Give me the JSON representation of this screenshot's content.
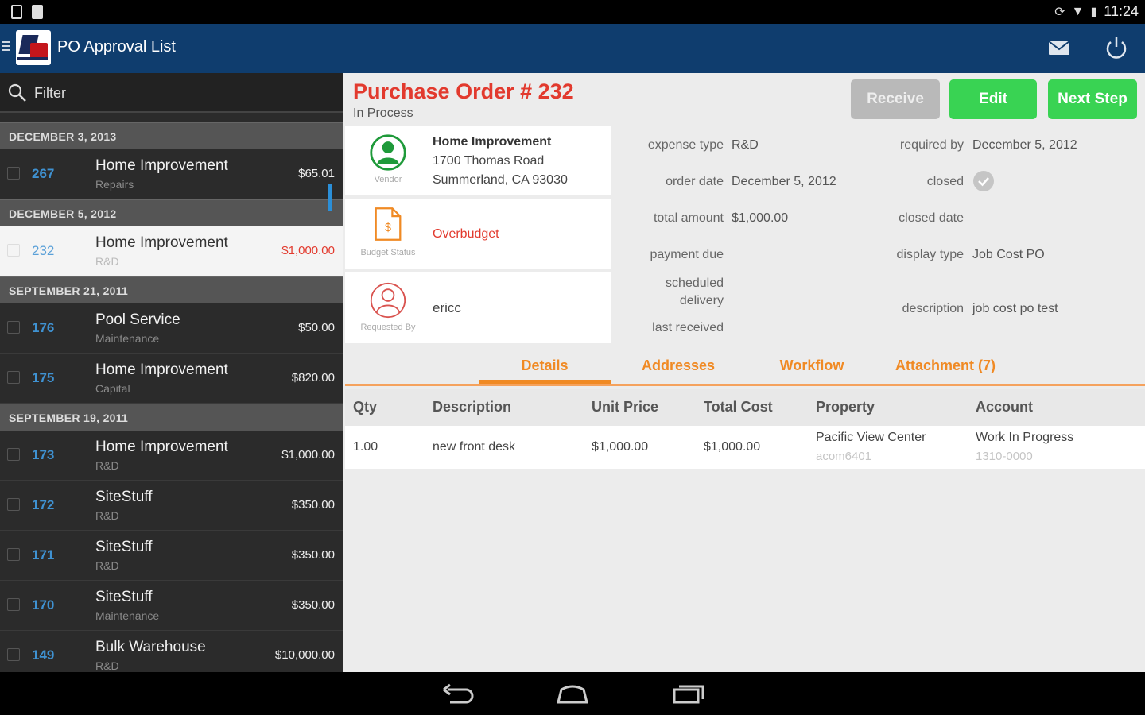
{
  "status_bar": {
    "time": "11:24"
  },
  "app_bar": {
    "title": "PO Approval List"
  },
  "filter": {
    "label": "Filter"
  },
  "list": {
    "sections": [
      {
        "date": "DECEMBER 3, 2013",
        "items": [
          {
            "number": "267",
            "vendor": "Home Improvement",
            "type": "Repairs",
            "amount": "$65.01"
          }
        ]
      },
      {
        "date": "DECEMBER 5, 2012",
        "items": [
          {
            "number": "232",
            "vendor": "Home Improvement",
            "type": "R&D",
            "amount": "$1,000.00",
            "selected": true
          }
        ]
      },
      {
        "date": "SEPTEMBER 21, 2011",
        "items": [
          {
            "number": "176",
            "vendor": "Pool Service",
            "type": "Maintenance",
            "amount": "$50.00"
          },
          {
            "number": "175",
            "vendor": "Home Improvement",
            "type": "Capital",
            "amount": "$820.00"
          }
        ]
      },
      {
        "date": "SEPTEMBER 19, 2011",
        "items": [
          {
            "number": "173",
            "vendor": "Home Improvement",
            "type": "R&D",
            "amount": "$1,000.00"
          },
          {
            "number": "172",
            "vendor": "SiteStuff",
            "type": "R&D",
            "amount": "$350.00"
          },
          {
            "number": "171",
            "vendor": "SiteStuff",
            "type": "R&D",
            "amount": "$350.00"
          },
          {
            "number": "170",
            "vendor": "SiteStuff",
            "type": "Maintenance",
            "amount": "$350.00"
          },
          {
            "number": "149",
            "vendor": "Bulk Warehouse",
            "type": "R&D",
            "amount": "$10,000.00"
          }
        ]
      }
    ]
  },
  "detail": {
    "title": "Purchase Order # 232",
    "status": "In Process",
    "buttons": {
      "receive": "Receive",
      "edit": "Edit",
      "next_step": "Next Step"
    },
    "vendor": {
      "caption": "Vendor",
      "name": "Home Improvement",
      "address": "1700 Thomas Road",
      "city": "Summerland, CA 93030"
    },
    "budget": {
      "caption": "Budget Status",
      "value": "Overbudget"
    },
    "requester": {
      "caption": "Requested By",
      "value": "ericc"
    },
    "fields": {
      "expense_type_label": "expense type",
      "expense_type": "R&D",
      "order_date_label": "order date",
      "order_date": "December 5, 2012",
      "total_amount_label": "total amount",
      "total_amount": "$1,000.00",
      "payment_due_label": "payment due",
      "scheduled_label_1": "scheduled",
      "scheduled_label_2": "delivery",
      "last_received_label": "last received",
      "required_by_label": "required by",
      "required_by": "December 5, 2012",
      "closed_label": "closed",
      "closed_date_label": "closed date",
      "display_type_label": "display type",
      "display_type": "Job Cost PO",
      "description_label": "description",
      "description": "job cost po test"
    },
    "tabs": [
      "Details",
      "Addresses",
      "Workflow",
      "Attachment (7)"
    ],
    "table": {
      "headers": [
        "Qty",
        "Description",
        "Unit Price",
        "Total Cost",
        "Property",
        "Account"
      ],
      "rows": [
        {
          "qty": "1.00",
          "description": "new front desk",
          "unit_price": "$1,000.00",
          "total_cost": "$1,000.00",
          "property": "Pacific View Center",
          "property_code": "acom6401",
          "account": "Work In Progress",
          "account_code": "1310-0000"
        }
      ]
    }
  },
  "colors": {
    "action_bar": "#0f3d6e",
    "accent_red": "#e23a2e",
    "green_button": "#39d353",
    "tab_orange": "#f08a24",
    "list_number_blue": "#3f92d2"
  }
}
